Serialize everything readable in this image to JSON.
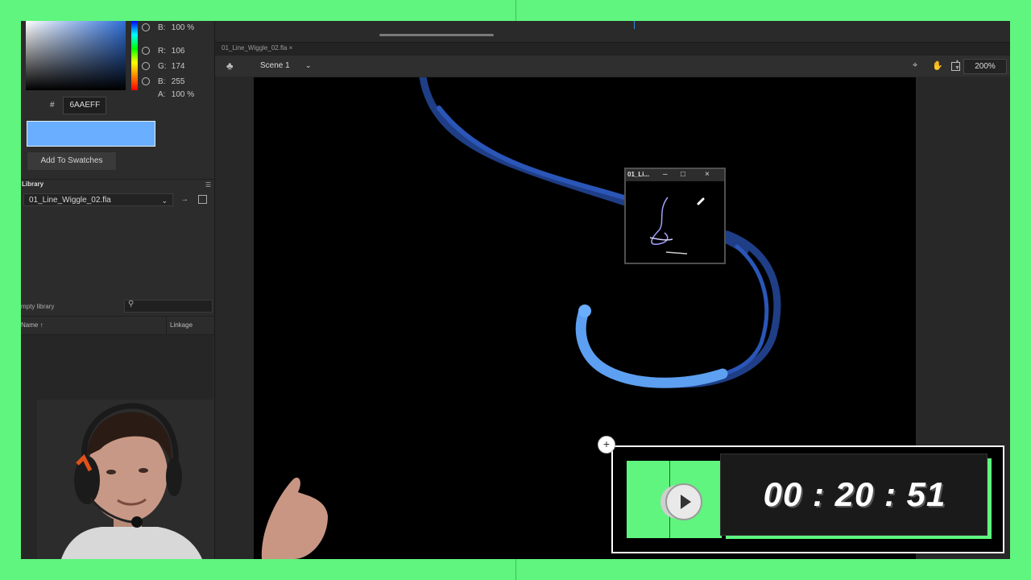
{
  "color_panel": {
    "top_b_label": "B:",
    "top_b_value": "100 %",
    "r_label": "R:",
    "r_value": "106",
    "g_label": "G:",
    "g_value": "174",
    "b_label": "B:",
    "b_value": "255",
    "a_label": "A:",
    "a_value": "100 %",
    "hex_prefix": "#",
    "hex_value": "6AAEFF",
    "swatch_color": "#6aaeff",
    "add_to_swatches": "Add To Swatches"
  },
  "library": {
    "tab_label": "Library",
    "document": "01_Line_Wiggle_02.fla",
    "empty_label": "mpty library",
    "col_name": "Name",
    "col_linkage": "Linkage"
  },
  "editor": {
    "doc_tab": "01_Line_Wiggle_02.fla",
    "scene": "Scene 1",
    "zoom": "200%"
  },
  "preview_window": {
    "title": "01_Li..."
  },
  "overlay": {
    "timer": "00 : 20 : 51"
  },
  "icons": {
    "scene": "scene-icon",
    "snap": "snap-icon",
    "hand": "hand-icon",
    "clip": "clip-stage-icon",
    "play": "play-icon"
  }
}
